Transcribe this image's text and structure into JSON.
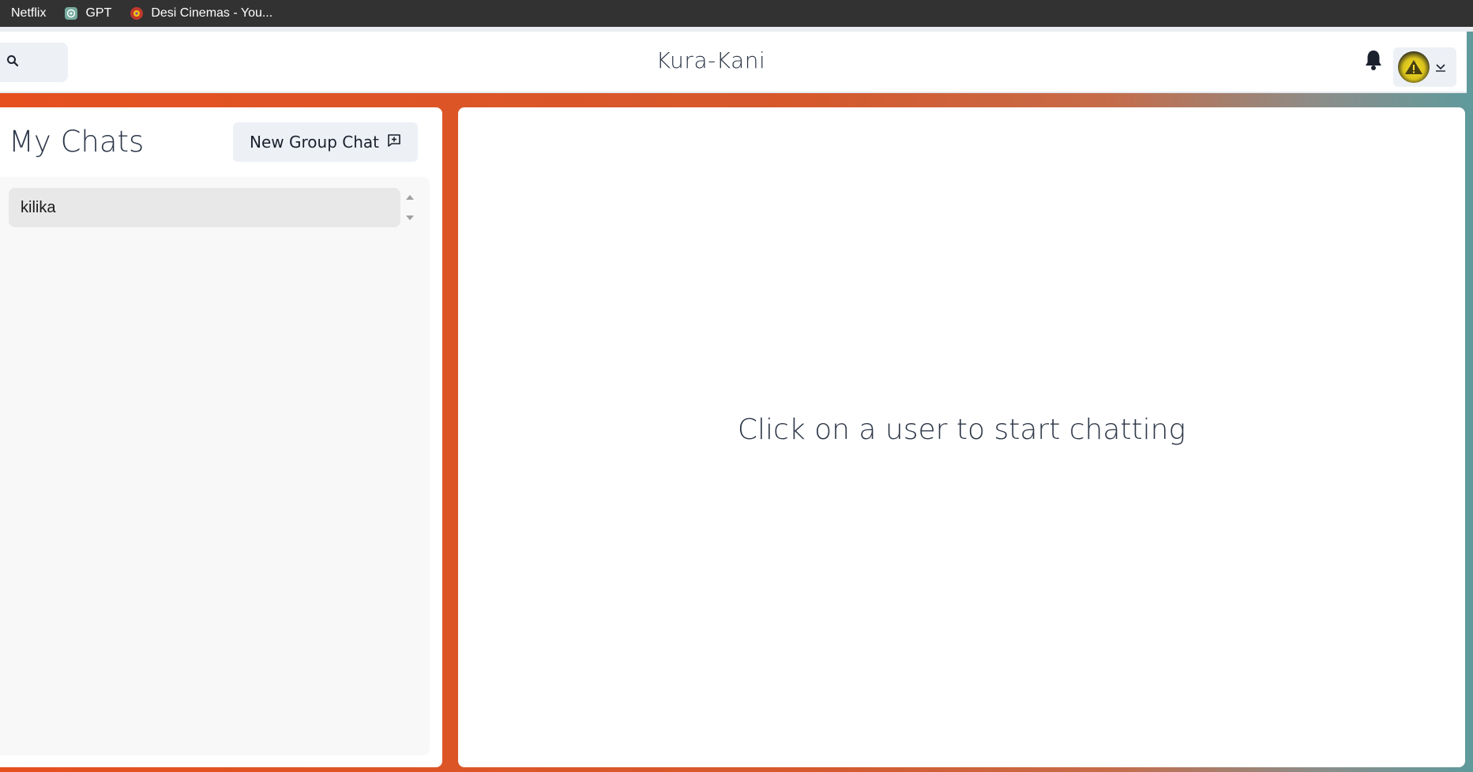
{
  "bookmarks": [
    {
      "label": "Netflix",
      "icon": "netflix-icon"
    },
    {
      "label": "GPT",
      "icon": "openai-icon"
    },
    {
      "label": "Desi Cinemas - You...",
      "icon": "desi-cinemas-icon"
    }
  ],
  "header": {
    "title": "Kura-Kani",
    "search_icon": "search-icon",
    "notification_icon": "bell-icon",
    "profile_chevron_icon": "chevron-down-icon"
  },
  "sidebar": {
    "title": "My Chats",
    "new_group_label": "New Group Chat",
    "new_group_icon": "add-chat-icon",
    "chats": [
      {
        "name": "kilika"
      }
    ]
  },
  "chat_box": {
    "empty_message": "Click on a user to start chatting"
  },
  "colors": {
    "accent_orange": "#e6501f",
    "accent_teal": "#5f9a9c",
    "panel_bg": "#ffffff",
    "button_bg": "#edf1f6"
  }
}
